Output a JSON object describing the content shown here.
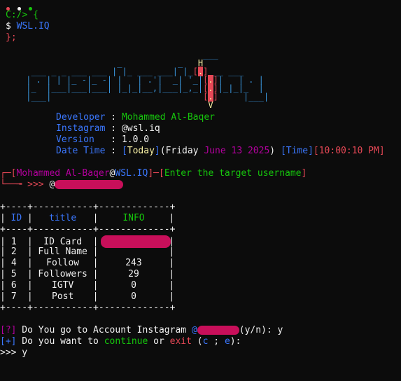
{
  "window": {
    "dots": [
      "#e74856",
      "#f2f2f2",
      "#16c60c"
    ]
  },
  "prompt": {
    "path": "C:/> {",
    "command_prefix": "$ ",
    "command": "WSL.IQ",
    "close": "};"
  },
  "banner_art": [
    "                                    ___",
    "                   _           _   H",
    "  ___ _ _ ___ ___ | |_ ___ ___| |_[.]___ ___",
    " | . | | |_ -|_ -| |   | .'|  _| '_|[.]|   | . |",
    " |_  |___|___|___| |_|_|__,|___|_,_|[.]|_|_|_  |",
    " |___|                              [.]     |___|",
    "                                     V"
  ],
  "info": {
    "developer_label": "Developer",
    "developer": "Mohammed Al-Baqer",
    "instagram_label": "Instagram",
    "instagram": "@wsl.iq",
    "version_label": "Version  ",
    "version": "1.0.0",
    "datetime_label": "Date Time",
    "today": "Today",
    "day": "Friday",
    "date": "June 13 2025",
    "time_label": "Time",
    "time": "10:00:10 PM"
  },
  "input_prompt": {
    "user": "Mohammed Al-Baqer",
    "host": "WSL.IQ",
    "hint": "Enter the target username",
    "arrow": "└──╼ >>> ",
    "at": "@"
  },
  "table": {
    "border": "+----+-----------+-------------+",
    "headers": [
      "ID",
      "title",
      "INFO"
    ],
    "rows": [
      {
        "id": "1",
        "title": "ID Card",
        "info": ""
      },
      {
        "id": "2",
        "title": "Full Name",
        "info": ""
      },
      {
        "id": "4",
        "title": "Follow",
        "info": "243"
      },
      {
        "id": "5",
        "title": "Followers",
        "info": "29"
      },
      {
        "id": "6",
        "title": "IGTV",
        "info": "0"
      },
      {
        "id": "7",
        "title": "Post",
        "info": "0"
      }
    ]
  },
  "questions": {
    "q1_tag": "[?]",
    "q1_text": " Do You go to Account Instagram ",
    "q1_at": "@",
    "q1_suffix": "(y/n): y",
    "q2_tag": "[+]",
    "q2_text": " Do you want to ",
    "q2_continue": "continue",
    "q2_or": " or ",
    "q2_exit": "exit",
    "q2_open": " (",
    "q2_c": "c",
    "q2_sep": " ; ",
    "q2_e": "e",
    "q2_close": "):",
    "final": ">>> y"
  }
}
